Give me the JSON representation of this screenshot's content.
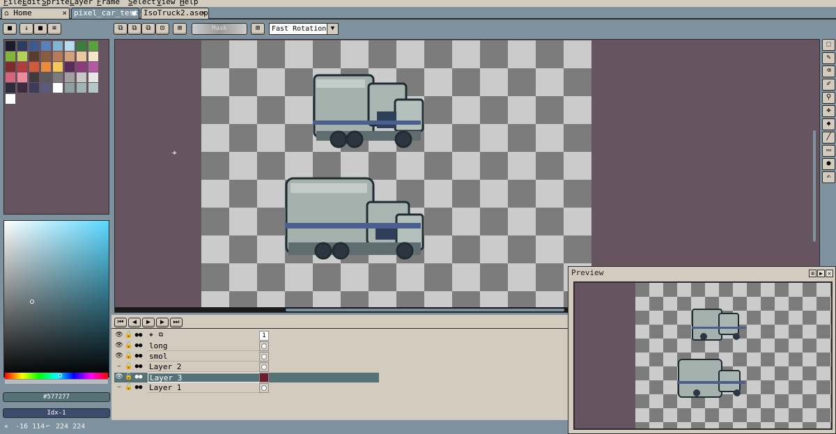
{
  "menubar": {
    "items": [
      "File",
      "Edit",
      "Sprite",
      "Layer",
      "Frame",
      "Select",
      "View",
      "Help"
    ]
  },
  "tabs": [
    {
      "label": "Home",
      "icon": "home-icon",
      "close": "×"
    },
    {
      "label": "pixel_car_test.",
      "modified": "●"
    },
    {
      "label": "IsoTruck2.asep",
      "close": "×"
    }
  ],
  "toolbar": {
    "mask_label": "Mask",
    "rotation_algorithm": "Fast Rotation"
  },
  "palette": {
    "rows": [
      [
        "#1a1c2c",
        "#2c3c5c",
        "#3c5a8c",
        "#5a82b4",
        "#82b4d2",
        "#b4dceb",
        "#3c7c3c",
        "#5aa03c"
      ],
      [
        "#82b43c",
        "#b4d25a",
        "#5a3c2c",
        "#8c5a3c",
        "#b47c5a",
        "#d2a07c",
        "#ebc8a0",
        "#f4e4c8"
      ],
      [
        "#7c2c2c",
        "#b43c3c",
        "#d25a3c",
        "#eb8c3c",
        "#f4c85a",
        "#5a2c5a",
        "#8c3c7c",
        "#b45aa0"
      ],
      [
        "#d2647c",
        "#eb8ca0",
        "#3c3c3c",
        "#5a5a5a",
        "#7c7c7c",
        "#a0a0a0",
        "#c8c8c8",
        "#e6e6e6"
      ],
      [
        "#2c2c3c",
        "#3c2c3c",
        "#3c3c5a",
        "#5a5a7c",
        "#ffffff",
        "#8ca0a0",
        "#a0b4b4",
        "#b4c8c8"
      ]
    ],
    "extra": "#ffffff"
  },
  "color_picker": {
    "hex": "#577277",
    "index": "Idx-1",
    "hue_position": 0.52
  },
  "timeline": {
    "controls": [
      "first-frame-icon",
      "prev-frame-icon",
      "play-icon",
      "next-frame-icon",
      "last-frame-icon"
    ],
    "frame_number": "1",
    "layers": [
      {
        "name": "long",
        "visible": true
      },
      {
        "name": "smol",
        "visible": true
      },
      {
        "name": "Layer 2",
        "visible": false
      },
      {
        "name": "Layer 3",
        "visible": true,
        "selected": true
      },
      {
        "name": "Layer 1",
        "visible": false
      }
    ]
  },
  "statusbar": {
    "cursor_pos": "-16 114",
    "sprite_size": "224 224"
  },
  "preview": {
    "title": "Preview"
  },
  "colors": {
    "ui_bg": "#7d929e",
    "panel": "#d3cbbe",
    "canvas_bg": "#665560",
    "selected_layer": "#577277"
  }
}
